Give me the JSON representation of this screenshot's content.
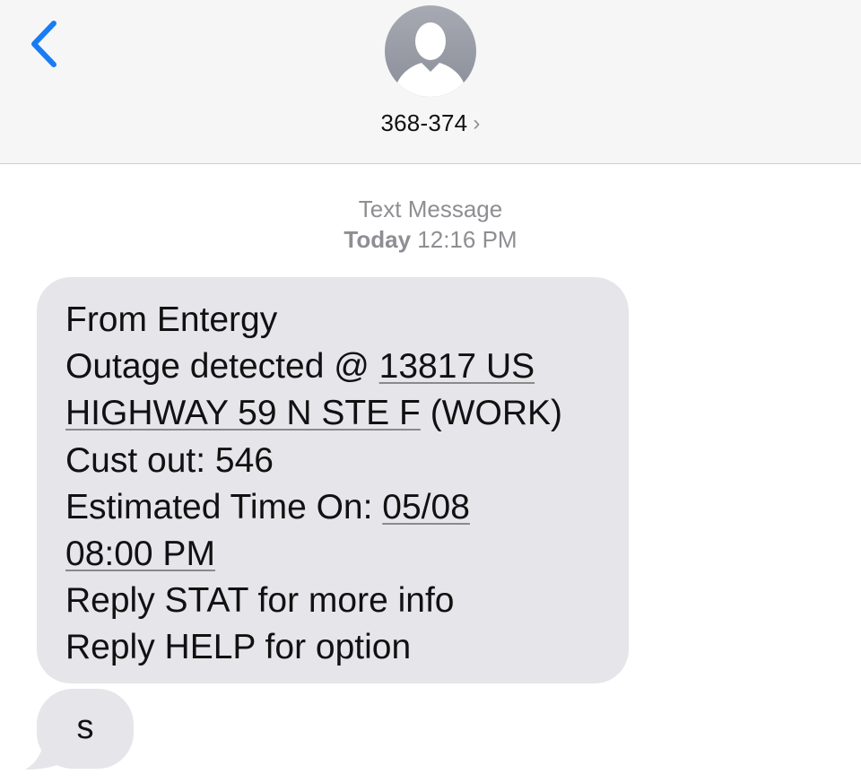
{
  "header": {
    "contact_name": "368-374",
    "contact_chevron": "›",
    "back_icon": "chevron-left-icon",
    "avatar_icon": "person-silhouette-icon"
  },
  "conversation": {
    "meta_type": "Text Message",
    "meta_day": "Today",
    "meta_time": "12:16 PM",
    "incoming": {
      "line1": "From Entergy",
      "line2_prefix": "Outage detected @ ",
      "line2_link": "13817 US",
      "line3_link": "HIGHWAY 59 N STE F",
      "line3_suffix": " (WORK)",
      "line4": "Cust out: 546",
      "line5_prefix": "Estimated Time On: ",
      "line5_link": "05/08",
      "line6_link": "08:00 PM",
      "line7": "Reply STAT for more info",
      "line8": "Reply HELP for option"
    },
    "reply": {
      "text": "s"
    }
  },
  "colors": {
    "accent": "#1a7cf5",
    "bubble_bg": "#e5e5ea",
    "header_bg": "#f6f6f6",
    "meta_text": "#8e8e93"
  }
}
